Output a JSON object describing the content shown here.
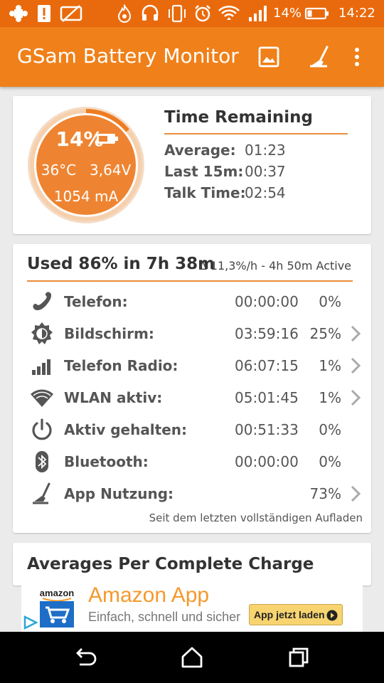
{
  "status_bar": {
    "battery_percent": "14%",
    "time": "14:22",
    "icons": [
      "puzzle-icon",
      "alert-icon",
      "no-image-icon",
      "flame-icon",
      "headset-icon",
      "vibrate-icon",
      "alarm-icon",
      "wifi-icon",
      "signal-icon",
      "battery-icon"
    ]
  },
  "app_bar": {
    "title": "GSam Battery Monitor",
    "actions": [
      "image-icon",
      "broom-icon",
      "overflow-menu-icon"
    ]
  },
  "battery": {
    "percent": "14%",
    "level_fraction": 0.14,
    "temperature": "36°C",
    "voltage": "3,64V",
    "current": "1054 mA"
  },
  "time_remaining": {
    "title": "Time Remaining",
    "rows": [
      {
        "label": "Average:",
        "value": "01:23"
      },
      {
        "label": "Last 15m:",
        "value": "00:37"
      },
      {
        "label": "Talk Time:",
        "value": "02:54"
      }
    ]
  },
  "usage": {
    "title": "Used 86% in 7h 38m",
    "subtitle": "∆ 11,3%/h - 4h 50m Active",
    "rows": [
      {
        "label": "Telefon:",
        "time": "00:00:00",
        "percent": "0%",
        "icon": "phone-icon",
        "chevron": false
      },
      {
        "label": "Bildschirm:",
        "time": "03:59:16",
        "percent": "25%",
        "icon": "brightness-icon",
        "chevron": true
      },
      {
        "label": "Telefon Radio:",
        "time": "06:07:15",
        "percent": "1%",
        "icon": "cell-signal-icon",
        "chevron": true
      },
      {
        "label": "WLAN aktiv:",
        "time": "05:01:45",
        "percent": "1%",
        "icon": "wifi-icon",
        "chevron": true
      },
      {
        "label": "Aktiv gehalten:",
        "time": "00:51:33",
        "percent": "0%",
        "icon": "power-icon",
        "chevron": false
      },
      {
        "label": "Bluetooth:",
        "time": "00:00:00",
        "percent": "0%",
        "icon": "bluetooth-icon",
        "chevron": false
      },
      {
        "label": "App Nutzung:",
        "time": "",
        "percent": "73%",
        "icon": "broom-icon",
        "chevron": true
      }
    ],
    "footnote": "Seit dem letzten vollständigen Aufladen"
  },
  "averages": {
    "title": "Averages Per Complete Charge"
  },
  "ad": {
    "logo_text": "amazon",
    "title": "Amazon App",
    "subtitle": "Einfach, schnell und sicher",
    "button_label": "App jetzt laden"
  },
  "colors": {
    "accent": "#f08019",
    "status_bar": "#e96a0c",
    "gauge_fill": "#ee8431",
    "divider": "#e98c3c"
  }
}
